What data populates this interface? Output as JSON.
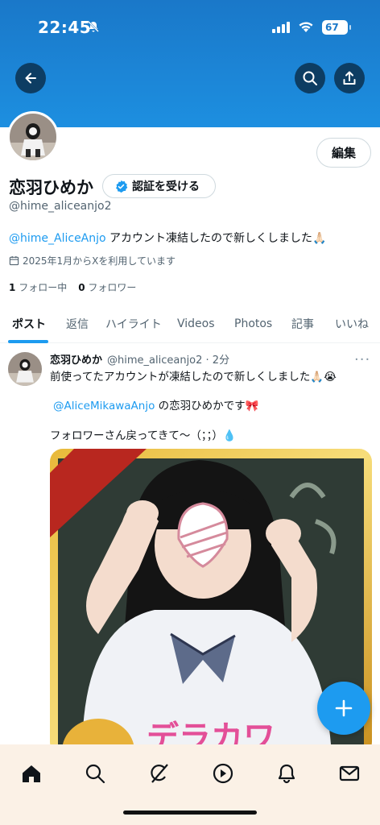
{
  "status_bar": {
    "time": "22:45",
    "battery": "67"
  },
  "profile": {
    "name": "恋羽ひめか",
    "verify_label": "認証を受ける",
    "handle": "@hime_aliceanjo2",
    "bio_mention": "@hime_AliceAnjo",
    "bio_text": " アカウント凍結したので新しくしました🙏🏻",
    "joined": "2025年1月からXを利用しています",
    "following_count": "1",
    "following_label": "フォロー中",
    "followers_count": "0",
    "followers_label": "フォロワー",
    "edit_label": "編集"
  },
  "tabs": [
    "ポスト",
    "返信",
    "ハイライト",
    "Videos",
    "Photos",
    "記事",
    "いいね"
  ],
  "post": {
    "author": "恋羽ひめか",
    "meta": "@hime_aliceanjo2 · 2分",
    "line1": "前使ってたアカウントが凍結したので新しくしました🙏🏻😭",
    "mention": "@AliceMikawaAnjo",
    "line2_text": " の恋羽ひめかです🎀",
    "line3": "フォロワーさん戻ってきて〜（；；）💧",
    "media_caption": "デラカワ"
  },
  "colors": {
    "accent": "#1d9bf0",
    "banner": "#1d8fe0",
    "nav_bg": "#fbf1e6"
  },
  "icons": [
    "back-arrow-icon",
    "search-icon",
    "share-icon",
    "verified-badge-icon",
    "calendar-icon",
    "home-icon",
    "explore-icon",
    "grok-icon",
    "video-icon",
    "notifications-icon",
    "messages-icon",
    "compose-plus-icon"
  ]
}
